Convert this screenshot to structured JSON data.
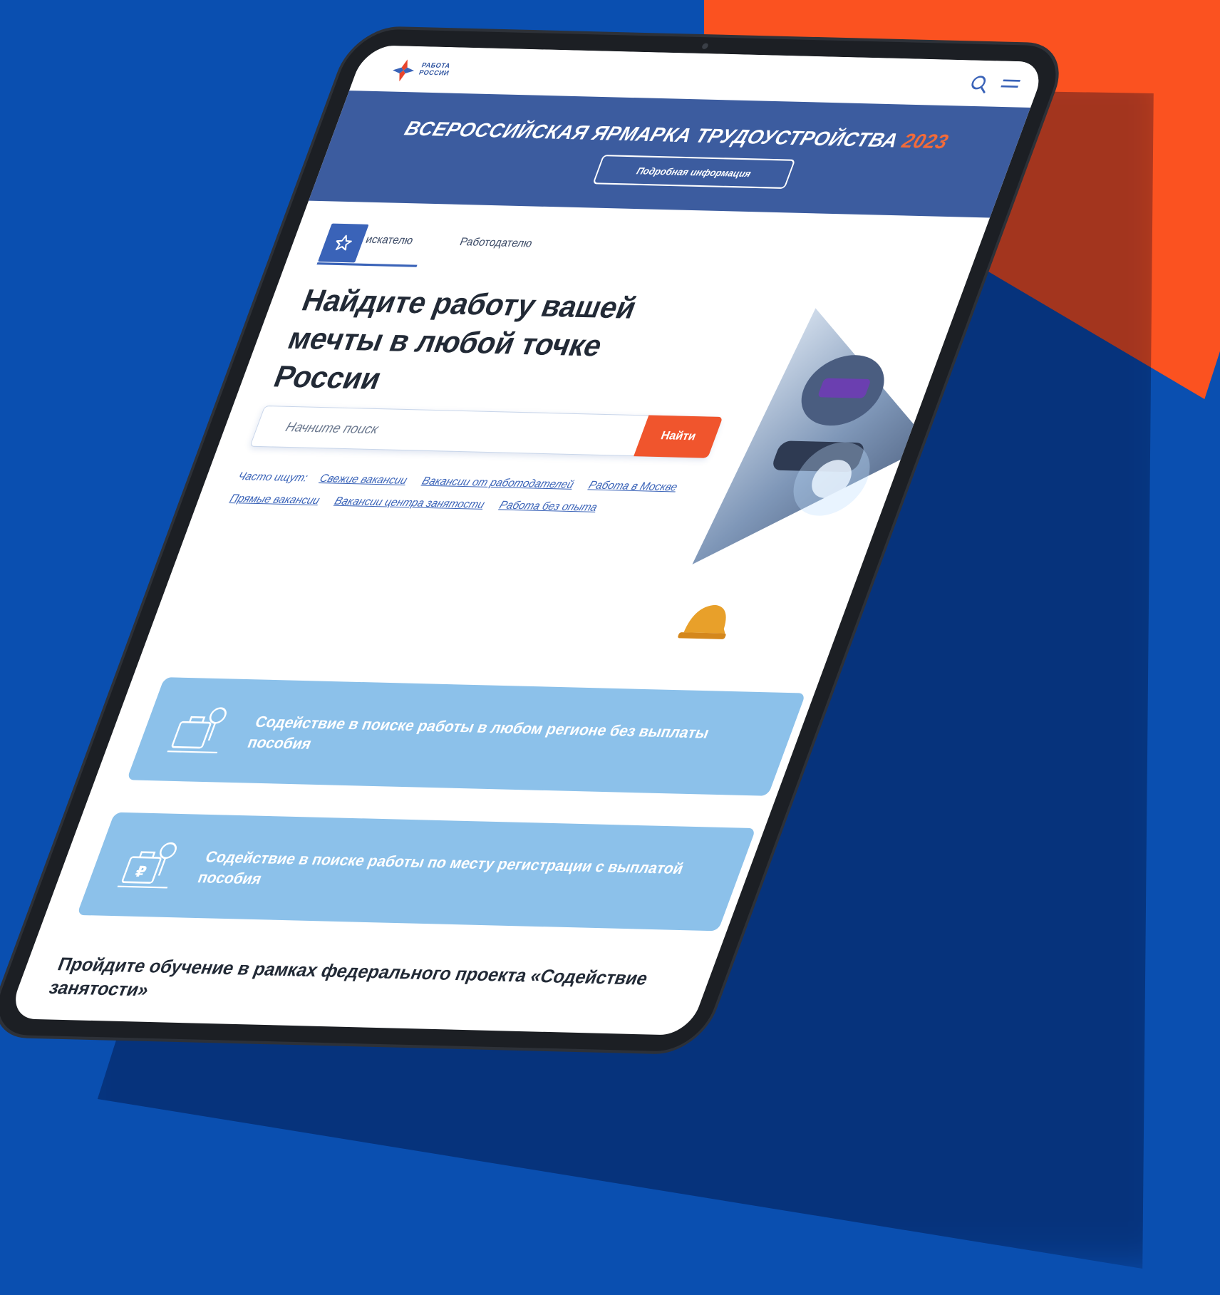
{
  "header": {
    "logo_line1": "РАБОТА",
    "logo_line2": "РОССИИ",
    "search_icon": "search-icon",
    "menu_icon": "hamburger-icon"
  },
  "banner": {
    "title": "ВСЕРОССИЙСКАЯ ЯРМАРКА ТРУДОУСТРОЙСТВА",
    "year": "2023",
    "button_label": "Подробная информация"
  },
  "tabs": [
    {
      "label": "Соискателю",
      "visible_label": "искателю",
      "active": true,
      "icon": "star-icon"
    },
    {
      "label": "Работодателю",
      "active": false
    }
  ],
  "hero": {
    "title": "Найдите работу вашей мечты в любой точке России",
    "search_placeholder": "Начните поиск",
    "search_button": "Найти"
  },
  "often_searched": {
    "label": "Часто ищут:",
    "links": [
      "Свежие вакансии",
      "Вакансии от работодателей",
      "Работа в Москве",
      "Прямые вакансии",
      "Вакансии центра занятости",
      "Работа без опыта"
    ]
  },
  "cards": [
    {
      "text": "Содействие в поиске работы в любом регионе без выплаты пособия",
      "icon": "briefcase-search-icon"
    },
    {
      "text": "Содействие в поиске работы по месту регистрации с выплатой пособия",
      "icon": "briefcase-ruble-icon"
    }
  ],
  "bottom": {
    "title": "Пройдите обучение в рамках федерального проекта «Содействие занятости»"
  },
  "colors": {
    "background": "#0a4fb0",
    "accent_orange": "#fb5220",
    "banner": "#3c5c9f",
    "card": "#8cc1ea",
    "button": "#f0552d"
  }
}
